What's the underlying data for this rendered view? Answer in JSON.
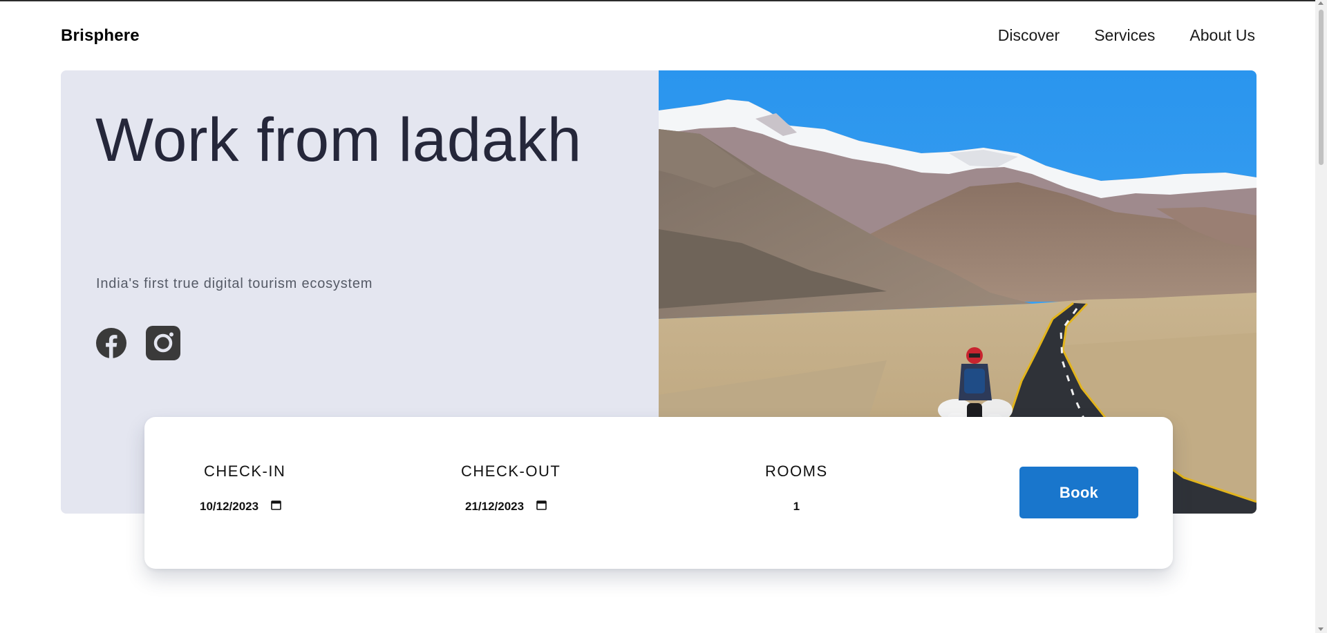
{
  "header": {
    "brand": "Brisphere",
    "nav": [
      {
        "label": "Discover"
      },
      {
        "label": "Services"
      },
      {
        "label": "About Us"
      }
    ]
  },
  "hero": {
    "title": "Work from ladakh",
    "subtitle": "India's first true digital tourism ecosystem",
    "social_icons": [
      "facebook-icon",
      "instagram-icon"
    ]
  },
  "booking": {
    "checkin": {
      "label": "CHECK-IN",
      "value": "10/12/2023"
    },
    "checkout": {
      "label": "CHECK-OUT",
      "value": "21/12/2023"
    },
    "rooms": {
      "label": "ROOMS",
      "value": "1"
    },
    "book_label": "Book"
  },
  "colors": {
    "hero_panel": "#e4e6f0",
    "title_text": "#25273a",
    "book_button": "#1976cc",
    "icon_dark": "#3a3a3a"
  }
}
